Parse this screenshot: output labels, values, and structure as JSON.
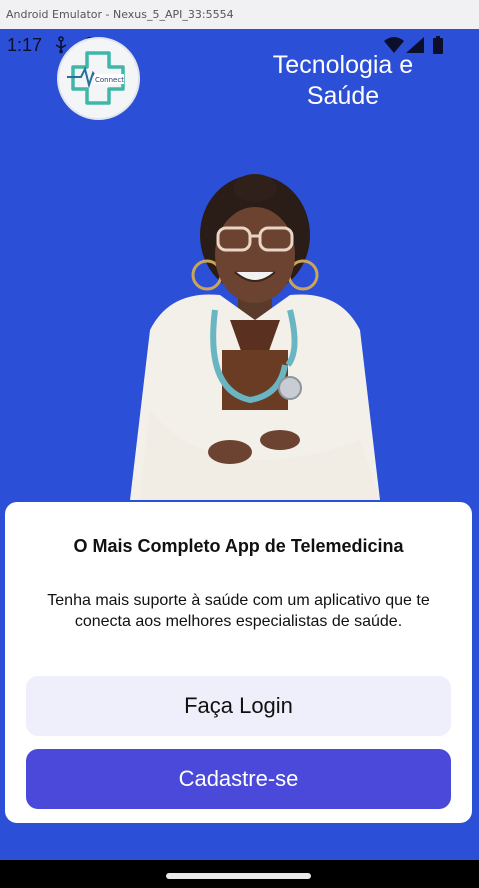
{
  "window": {
    "title": "Android Emulator - Nexus_5_API_33:5554"
  },
  "statusbar": {
    "time": "1:17",
    "icons": [
      "usb-icon",
      "sd-card-icon",
      "wifi-icon",
      "signal-icon",
      "battery-icon"
    ]
  },
  "header": {
    "logo_text": "Connect",
    "title": "Tecnologia e Saúde"
  },
  "card": {
    "title": "O Mais Completo App de Telemedicina",
    "description": "Tenha mais suporte à saúde com um aplicativo que te conecta aos melhores especialistas de saúde.",
    "login_label": "Faça Login",
    "register_label": "Cadastre-se"
  },
  "colors": {
    "background": "#2c4fd7",
    "primary_button": "#4a49d9",
    "secondary_button": "#efeffb",
    "logo_teal": "#3fb7a8"
  }
}
